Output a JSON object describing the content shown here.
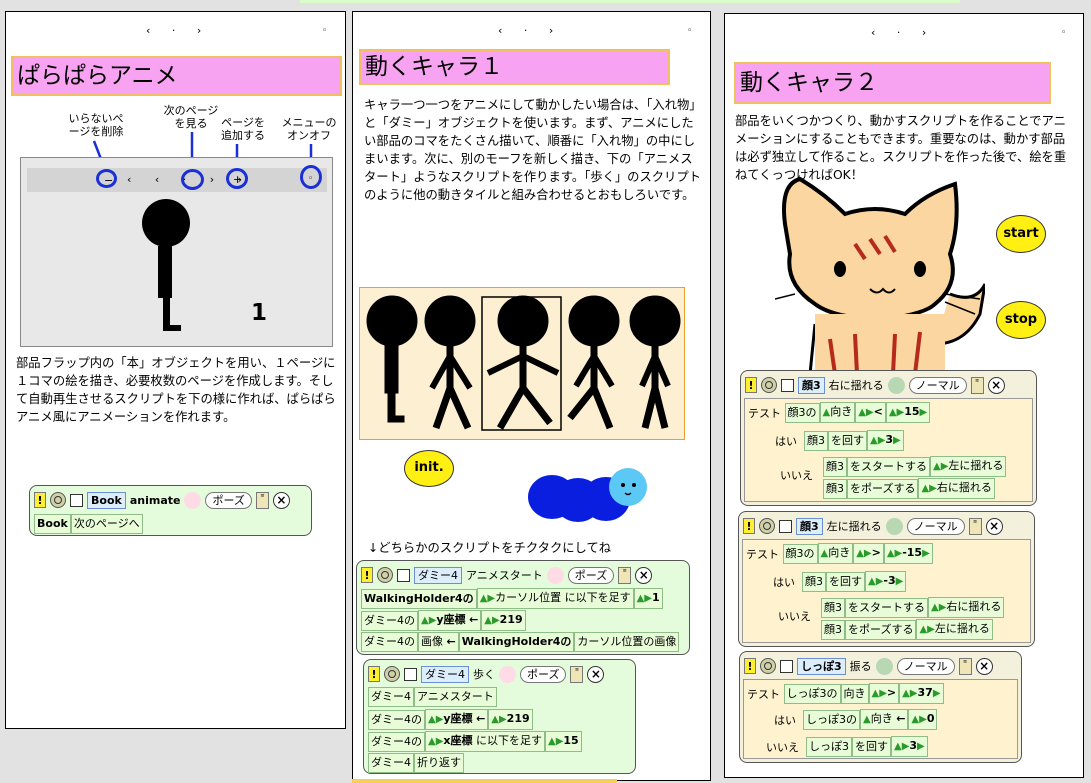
{
  "pages": [
    {
      "nav_arrows": "‹ · ›",
      "menu_dot": "◦",
      "title": "ぱらぱらアニメ",
      "labels": {
        "remove_page": "いらないぺ\nージを削除",
        "next_page": "次のページ\nを見る",
        "add_page": "ページを\n追加する",
        "menu_toggle": "メニューの\nオンオフ"
      },
      "inner_nav": {
        "minus": "−",
        "arrows": "‹ ‹ · › ›",
        "plus": "+",
        "menu": "◦",
        "page_number": "1"
      },
      "description": "部品フラップ内の「本」オブジェクトを用い、１ページに１コマの絵を描き、必要枚数のページを作成します。そして自動再生させるスクリプトを下の様に作れば、ぱらぱらアニメ風にアニメーションを作れます。",
      "script": {
        "object": "Book",
        "name": "animate",
        "state": "ポーズ",
        "row1_obj": "Book",
        "row1_cmd": "次のページへ"
      }
    },
    {
      "nav_arrows": "‹ · ›",
      "menu_dot": "◦",
      "title": "動くキャラ１",
      "description": "キャラ一つ一つをアニメにして動かしたい場合は、「入れ物」と「ダミー」オブジェクトを使います。まず、アニメにしたい部品のコマをたくさん描いて、順番に「入れ物」の中にしまいます。次に、別のモーフを新しく描き、下の「アニメスタート」ようなスクリプトを作ります。「歩く」のスクリプトのように他の動きタイルと組み合わせるとおもしろいです。",
      "init_button": "init.",
      "hint": "↓どちらかのスクリプトをチクタクにしてね",
      "script1": {
        "object": "ダミー4",
        "name": "アニメスタート",
        "state": "ポーズ",
        "rows": [
          [
            "WalkingHolder4の",
            "カーソル位置",
            "に以下を足す",
            "1"
          ],
          [
            "ダミー4の",
            "y座標",
            "←",
            "219"
          ],
          [
            "ダミー4の",
            "画像",
            "←",
            "WalkingHolder4の",
            "カーソル位置の画像"
          ]
        ]
      },
      "script2": {
        "object": "ダミー4",
        "name": "歩く",
        "state": "ポーズ",
        "rows": [
          [
            "ダミー4",
            "アニメスタート"
          ],
          [
            "ダミー4の",
            "y座標",
            "←",
            "219"
          ],
          [
            "ダミー4の",
            "x座標",
            "に以下を足す",
            "15"
          ],
          [
            "ダミー4",
            "折り返す"
          ]
        ]
      }
    },
    {
      "nav_arrows": "‹ · ›",
      "menu_dot": "◦",
      "title": "動くキャラ２",
      "description": "部品をいくつかつくり、動かすスクリプトを作ることでアニメーションにすることもできます。重要なのは、動かす部品は必ず独立して作ること。スクリプトを作った後で、絵を重ねてくっつければOK！",
      "start_button": "start",
      "stop_button": "stop",
      "scripts": [
        {
          "object": "顔3",
          "name": "右に揺れる",
          "state": "ノーマル",
          "test_label": "テスト",
          "test": [
            "顔3の",
            "向き",
            "<",
            "15"
          ],
          "yes_label": "はい",
          "yes": [
            "顔3",
            "を回す",
            "3"
          ],
          "no_label": "いいえ",
          "no": [
            [
              "顔3",
              "をスタートする",
              "左に揺れる"
            ],
            [
              "顔3",
              "をポーズする",
              "右に揺れる"
            ]
          ]
        },
        {
          "object": "顔3",
          "name": "左に揺れる",
          "state": "ノーマル",
          "test_label": "テスト",
          "test": [
            "顔3の",
            "向き",
            ">",
            "-15"
          ],
          "yes_label": "はい",
          "yes": [
            "顔3",
            "を回す",
            "-3"
          ],
          "no_label": "いいえ",
          "no": [
            [
              "顔3",
              "をスタートする",
              "右に揺れる"
            ],
            [
              "顔3",
              "をポーズする",
              "左に揺れる"
            ]
          ]
        },
        {
          "object": "しっぽ3",
          "name": "振る",
          "state": "ノーマル",
          "test_label": "テスト",
          "test": [
            "しっぽ3の",
            "向き",
            ">",
            "37"
          ],
          "yes_label": "はい",
          "yes": [
            "しっぽ3の",
            "向き",
            "←",
            "0"
          ],
          "no_label": "いいえ",
          "no": [
            [
              "しっぽ3",
              "を回す",
              "3"
            ]
          ]
        }
      ]
    }
  ],
  "colors": {
    "title_bg": "#f8a3f2",
    "title_border": "#f0c060",
    "script_bg": "#e4fbdc",
    "button_yellow": "#ffef12",
    "ring_blue": "#1b2fd6"
  }
}
